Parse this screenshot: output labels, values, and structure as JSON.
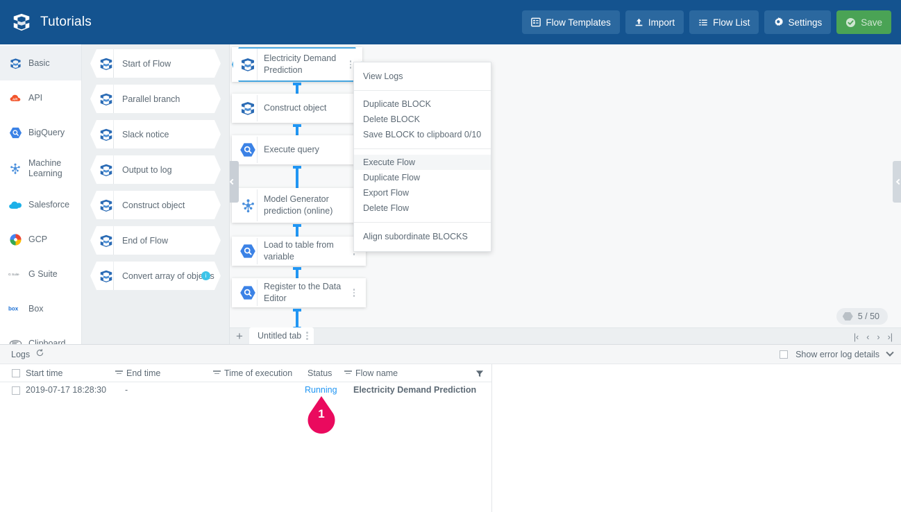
{
  "header": {
    "logo_icon": "trocco-cube-logo",
    "title": "Tutorials",
    "actions": [
      {
        "label": "Flow Templates",
        "icon": "template-icon",
        "variant": "normal"
      },
      {
        "label": "Import",
        "icon": "upload-icon",
        "variant": "normal"
      },
      {
        "label": "Flow List",
        "icon": "list-icon",
        "variant": "normal"
      },
      {
        "label": "Settings",
        "icon": "gear-icon",
        "variant": "normal"
      },
      {
        "label": "Save",
        "icon": "check-circle-icon",
        "variant": "save"
      }
    ]
  },
  "sidebar": {
    "items": [
      {
        "label": "Basic",
        "icon": "cube-icon",
        "active": true
      },
      {
        "label": "API",
        "icon": "api-cloud-icon",
        "active": false
      },
      {
        "label": "BigQuery",
        "icon": "bigquery-icon",
        "active": false
      },
      {
        "label": "Machine Learning",
        "icon": "machine-learning-icon",
        "active": false
      },
      {
        "label": "Salesforce",
        "icon": "salesforce-cloud-icon",
        "active": false
      },
      {
        "label": "GCP",
        "icon": "gcp-icon",
        "active": false
      },
      {
        "label": "G Suite",
        "icon": "gsuite-icon",
        "active": false
      },
      {
        "label": "Box",
        "icon": "box-icon",
        "active": false
      },
      {
        "label": "Clipboard",
        "icon": "clipboard-icon",
        "active": false
      }
    ]
  },
  "palette": {
    "items": [
      {
        "label": "Start of Flow",
        "icon": "cube-icon",
        "badge": null
      },
      {
        "label": "Parallel branch",
        "icon": "cube-icon",
        "badge": null
      },
      {
        "label": "Slack notice",
        "icon": "cube-icon",
        "badge": null
      },
      {
        "label": "Output to log",
        "icon": "cube-icon",
        "badge": null
      },
      {
        "label": "Construct object",
        "icon": "cube-icon",
        "badge": null
      },
      {
        "label": "End of Flow",
        "icon": "cube-icon",
        "badge": null
      },
      {
        "label": "Convert array of objects",
        "icon": "cube-icon",
        "badge": "info"
      }
    ]
  },
  "canvas": {
    "blocks": [
      {
        "label": "Electricity Demand Prediction",
        "icon": "cube-icon",
        "selected": true
      },
      {
        "label": "Construct object",
        "icon": "cube-icon",
        "selected": false
      },
      {
        "label": "Execute query",
        "icon": "bigquery-icon",
        "selected": false
      },
      {
        "label": "Model Generator prediction (online)",
        "icon": "machine-learning-icon",
        "selected": false
      },
      {
        "label": "Load to table from variable",
        "icon": "bigquery-icon",
        "selected": false
      },
      {
        "label": "Register to the Data Editor",
        "icon": "bigquery-icon",
        "selected": false
      }
    ],
    "count_badge": "5 / 50",
    "collapse_left_icon": "chevron-left-icon",
    "collapse_right_icon": "chevron-left-icon"
  },
  "context_menu": {
    "groups": [
      {
        "items": [
          {
            "label": "View Logs",
            "highlighted": false
          }
        ]
      },
      {
        "items": [
          {
            "label": "Duplicate BLOCK",
            "highlighted": false
          },
          {
            "label": "Delete BLOCK",
            "highlighted": false
          },
          {
            "label": "Save BLOCK to clipboard 0/10",
            "highlighted": false
          }
        ]
      },
      {
        "items": [
          {
            "label": "Execute Flow",
            "highlighted": true
          },
          {
            "label": "Duplicate Flow",
            "highlighted": false
          },
          {
            "label": "Export Flow",
            "highlighted": false
          },
          {
            "label": "Delete Flow",
            "highlighted": false
          }
        ]
      },
      {
        "items": [
          {
            "label": "Align subordinate BLOCKS",
            "highlighted": false
          }
        ]
      }
    ]
  },
  "tabbar": {
    "add_label": "+",
    "tabs": [
      {
        "label": "Untitled tab"
      }
    ],
    "pager": {
      "first": "|‹",
      "prev": "‹",
      "next": "›",
      "last": "›|"
    }
  },
  "logs": {
    "title": "Logs",
    "refresh_icon": "refresh-icon",
    "show_error_label": "Show error log details",
    "collapse_icon": "chevron-down-icon",
    "columns": [
      {
        "label": "Start time",
        "sortable": false
      },
      {
        "label": "End time",
        "sortable": true
      },
      {
        "label": "Time of execution",
        "sortable": true
      },
      {
        "label": "Status",
        "sortable": false
      },
      {
        "label": "Flow name",
        "sortable": true
      }
    ],
    "rows": [
      {
        "start_time": "2019-07-17 18:28:30",
        "end_time": "-",
        "time_of_execution": "",
        "status": "Running",
        "flow_name": "Electricity Demand Prediction"
      }
    ],
    "filter_icon": "filter-icon"
  },
  "annotation": {
    "marker_number": "1",
    "marker_color": "#ea0a5e"
  }
}
